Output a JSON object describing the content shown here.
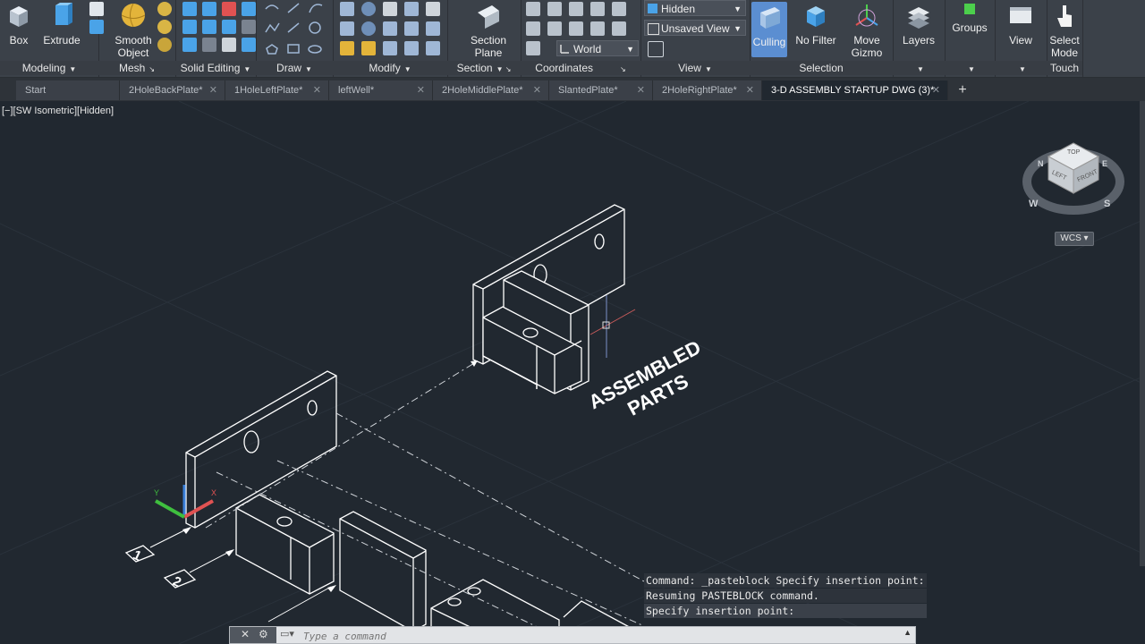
{
  "ribbon": {
    "modeling": {
      "box": "Box",
      "extrude": "Extrude",
      "label": "Modeling"
    },
    "mesh": {
      "smooth_line1": "Smooth",
      "smooth_line2": "Object",
      "label": "Mesh"
    },
    "solid_editing": {
      "label": "Solid Editing"
    },
    "draw": {
      "label": "Draw"
    },
    "modify": {
      "label": "Modify"
    },
    "section": {
      "plane_line1": "Section",
      "plane_line2": "Plane",
      "label": "Section"
    },
    "coordinates": {
      "world": "World",
      "label": "Coordinates"
    },
    "view": {
      "visual_style": "Hidden",
      "saved_view": "Unsaved View",
      "label": "View"
    },
    "selection": {
      "culling": "Culling",
      "no_filter": "No Filter",
      "gizmo_line1": "Move",
      "gizmo_line2": "Gizmo",
      "label": "Selection"
    },
    "layers": {
      "label": "Layers"
    },
    "groups": {
      "label": "Groups"
    },
    "view_panel": {
      "label": "View"
    },
    "touch": {
      "select_line1": "Select",
      "select_line2": "Mode",
      "label": "Touch"
    }
  },
  "tabs": [
    {
      "label": "Start"
    },
    {
      "label": "2HoleBackPlate*"
    },
    {
      "label": "1HoleLeftPlate*"
    },
    {
      "label": "leftWell*"
    },
    {
      "label": "2HoleMiddlePlate*"
    },
    {
      "label": "SlantedPlate*"
    },
    {
      "label": "2HoleRightPlate*"
    },
    {
      "label": "3-D ASSEMBLY STARTUP DWG (3)*"
    }
  ],
  "viewport": {
    "label": "[−][SW Isometric][Hidden]",
    "annotation_line1": "ASSEMBLED",
    "annotation_line2": "PARTS",
    "callouts": [
      "1",
      "2"
    ],
    "viewcube": {
      "top": "TOP",
      "left": "LEFT",
      "front": "FRONT",
      "n": "N",
      "e": "E",
      "s": "S",
      "w": "W",
      "wcs": "WCS"
    }
  },
  "command": {
    "history": [
      "Command: _pasteblock Specify insertion point:",
      "Resuming PASTEBLOCK command.",
      "Specify insertion point:"
    ],
    "placeholder": "Type a command"
  },
  "colors": {
    "ribbon_bg": "#3b4149",
    "viewport_bg": "#212830",
    "selection_accent": "#5b8ed1"
  }
}
